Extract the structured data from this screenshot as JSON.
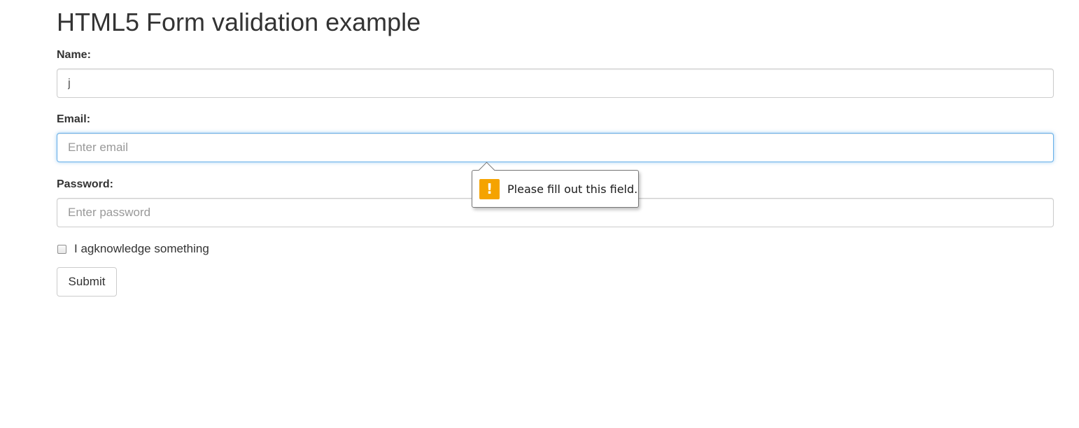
{
  "page": {
    "title": "HTML5 Form validation example"
  },
  "form": {
    "name": {
      "label": "Name:",
      "value": "j"
    },
    "email": {
      "label": "Email:",
      "value": "",
      "placeholder": "Enter email"
    },
    "password": {
      "label": "Password:",
      "value": "",
      "placeholder": "Enter password"
    },
    "checkbox": {
      "label": "I agknowledge something",
      "checked": false
    },
    "submit_label": "Submit"
  },
  "validation_tooltip": {
    "icon": "warning-icon",
    "icon_glyph": "!",
    "icon_color": "#f5a300",
    "message": "Please fill out this field."
  }
}
